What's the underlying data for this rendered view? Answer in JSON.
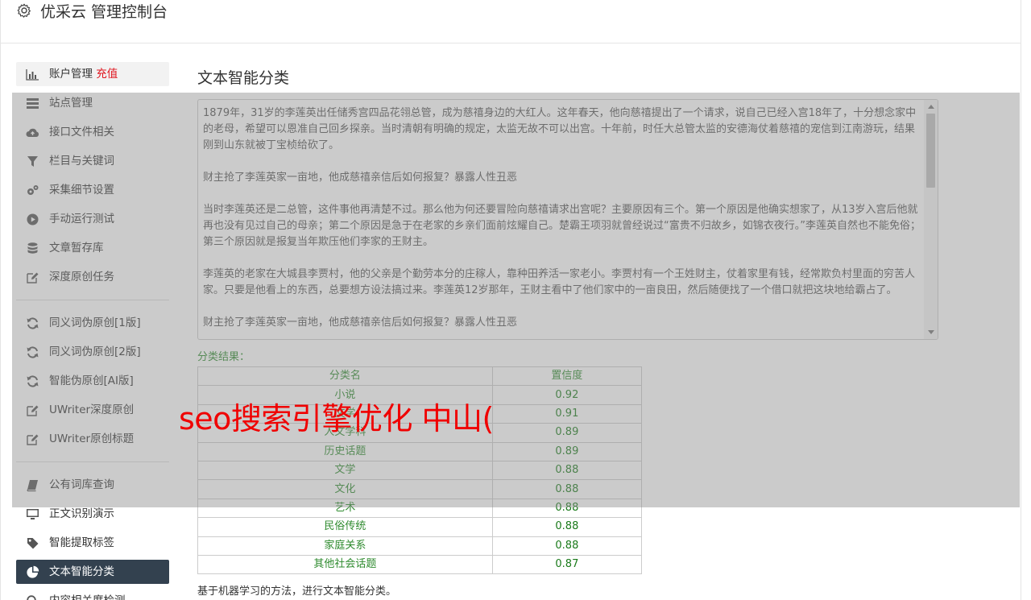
{
  "header": {
    "title": "优采云 管理控制台",
    "icon": "gear-icon"
  },
  "sidebar": {
    "groups": [
      {
        "items": [
          {
            "label": "账户管理",
            "badge": "充值",
            "icon": "bar-chart-icon"
          },
          {
            "label": "站点管理",
            "icon": "list-icon"
          },
          {
            "label": "接口文件相关",
            "icon": "cloud-upload-icon"
          },
          {
            "label": "栏目与关键词",
            "icon": "filter-icon"
          },
          {
            "label": "采集细节设置",
            "icon": "cogs-icon"
          },
          {
            "label": "手动运行测试",
            "icon": "play-circle-icon"
          },
          {
            "label": "文章暂存库",
            "icon": "database-icon"
          },
          {
            "label": "深度原创任务",
            "icon": "edit-icon"
          }
        ]
      },
      {
        "items": [
          {
            "label": "同义词伪原创[1版]",
            "icon": "refresh-icon"
          },
          {
            "label": "同义词伪原创[2版]",
            "icon": "refresh-icon"
          },
          {
            "label": "智能伪原创[AI版]",
            "icon": "refresh-icon"
          },
          {
            "label": "UWriter深度原创",
            "icon": "edit-icon"
          },
          {
            "label": "UWriter原创标题",
            "icon": "edit-icon"
          }
        ]
      },
      {
        "items": [
          {
            "label": "公有词库查询",
            "icon": "book-icon"
          },
          {
            "label": "正文识别演示",
            "icon": "monitor-icon"
          },
          {
            "label": "智能提取标签",
            "icon": "tag-icon"
          },
          {
            "label": "文本智能分类",
            "icon": "pie-chart-icon",
            "active": true
          },
          {
            "label": "内容相关度检测",
            "icon": "search-icon"
          }
        ]
      }
    ]
  },
  "main": {
    "title": "文本智能分类",
    "article": [
      "1879年，31岁的李莲英出任储秀宫四品花翎总管，成为慈禧身边的大红人。这年春天，他向慈禧提出了一个请求，说自己已经入宫18年了，十分想念家中的老母，希望可以恩准自己回乡探亲。当时清朝有明确的规定，太监无故不可以出宫。十年前，时任大总管太监的安德海仗着慈禧的宠信到江南游玩，结果刚到山东就被丁宝桢给砍了。",
      "财主抢了李莲英家一亩地，他成慈禧亲信后如何报复？暴露人性丑恶",
      "当时李莲英还是二总管，这件事他再清楚不过。那么他为何还要冒险向慈禧请求出宫呢？主要原因有三个。第一个原因是他确实想家了，从13岁入宫后他就再也没有见过自己的母亲；第二个原因是急于在老家的乡亲们面前炫耀自己。楚霸王项羽就曾经说过“富贵不归故乡，如锦衣夜行。”李莲英自然也不能免俗；第三个原因就是报复当年欺压他们李家的王财主。",
      "李莲英的老家在大城县李贾村，他的父亲是个勤劳本分的庄稼人，靠种田养活一家老小。李贾村有一个王姓财主，仗着家里有钱，经常欺负村里面的穷苦人家。只要是他看上的东西，总要想方设法搞过来。李莲英12岁那年，王财主看中了他们家中的一亩良田，然后随便找了一个借口就把这块地给霸占了。",
      "财主抢了李莲英家一亩地，他成慈禧亲信后如何报复？暴露人性丑恶"
    ],
    "result_label": "分类结果：",
    "table": {
      "headers": [
        "分类名",
        "置信度"
      ],
      "rows": [
        [
          "小说",
          "0.92"
        ],
        [
          "文学",
          "0.91"
        ],
        [
          "人文学科",
          "0.89"
        ],
        [
          "历史话题",
          "0.89"
        ],
        [
          "文学",
          "0.88"
        ],
        [
          "文化",
          "0.88"
        ],
        [
          "艺术",
          "0.88"
        ],
        [
          "民俗传统",
          "0.88"
        ],
        [
          "家庭关系",
          "0.88"
        ],
        [
          "其他社会话题",
          "0.87"
        ]
      ]
    },
    "footer_note": "基于机器学习的方法，进行文本智能分类。"
  },
  "watermark": "seo搜索引擎优化 中山(",
  "colors": {
    "active_bg": "#33414f",
    "badge_red": "#e0141d",
    "result_green": "#2d8a2d",
    "watermark_red": "#f00000"
  }
}
